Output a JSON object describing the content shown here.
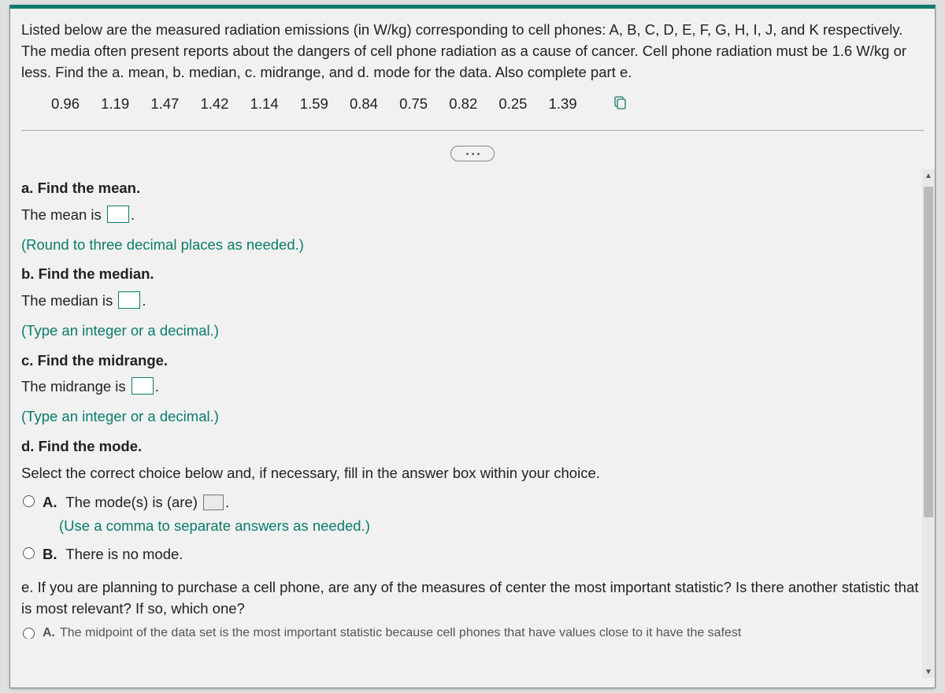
{
  "problem": {
    "intro": "Listed below are the measured radiation emissions (in W/kg) corresponding to cell phones: A, B, C, D, E, F, G, H, I, J, and K respectively. The media often present reports about the dangers of cell phone radiation as a cause of cancer. Cell phone radiation must be 1.6 W/kg or less. Find the a. mean, b. median, c. midrange, and d. mode for the data. Also complete part e.",
    "data_values": [
      "0.96",
      "1.19",
      "1.47",
      "1.42",
      "1.14",
      "1.59",
      "0.84",
      "0.75",
      "0.82",
      "0.25",
      "1.39"
    ]
  },
  "parts": {
    "a": {
      "head": "a. Find the mean.",
      "line": "The mean is",
      "after": ".",
      "instr": "(Round to three decimal places as needed.)"
    },
    "b": {
      "head": "b. Find the median.",
      "line": "The median is",
      "after": ".",
      "instr": "(Type an integer or a decimal.)"
    },
    "c": {
      "head": "c. Find the midrange.",
      "line": "The midrange is",
      "after": ".",
      "instr": "(Type an integer or a decimal.)"
    },
    "d": {
      "head": "d. Find the mode.",
      "prompt": "Select the correct choice below and, if necessary, fill in the answer box within your choice.",
      "choiceA": {
        "label": "A.",
        "text_before": "The mode(s) is (are)",
        "after": ".",
        "instr": "(Use a comma to separate answers as needed.)"
      },
      "choiceB": {
        "label": "B.",
        "text": "There is no mode."
      }
    },
    "e": {
      "text": "e. If you are planning to purchase a cell phone, are any of the measures of center the most important statistic? Is there another statistic that is most relevant? If so, which one?"
    }
  },
  "cutoff_preview": {
    "label": "A.",
    "fragment": "The midpoint of the data set is the most important statistic because cell phones that have values close to it have the safest"
  }
}
